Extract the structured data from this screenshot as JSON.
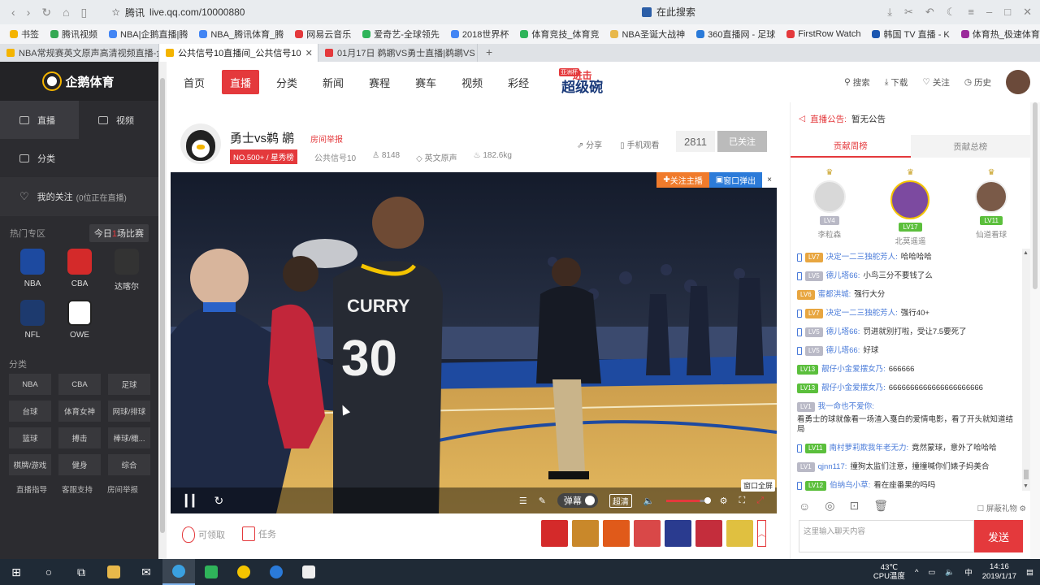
{
  "browser": {
    "url": "live.qq.com/10000880",
    "url_prefix": "腾讯",
    "search_label": "在此搜索",
    "bookmarks": [
      "书签",
      "腾讯视频",
      "NBA|企鹅直播|腾",
      "NBA_腾讯体育_腾",
      "网易云音乐",
      "爱奇艺-全球领先",
      "2018世界杯",
      "体育竞技_体育竞",
      "NBA圣诞大战神",
      "360直播网 - 足球",
      "FirstRow Watch",
      "韩国 TV 直播 - K",
      "体育热_极速体育"
    ],
    "tabs": [
      {
        "label": "NBA常规赛英文原声高清视频直播-企",
        "active": false
      },
      {
        "label": "公共信号10直播间_公共信号10",
        "active": true
      },
      {
        "label": "01月17日 鹈鹕VS勇士直播|鹈鹕VS",
        "active": false
      }
    ]
  },
  "sidebar": {
    "brand": "企鹅体育",
    "nav": [
      "直播",
      "视频",
      "分类"
    ],
    "my_follow": "我的关注",
    "my_follow_sub": "(0位正在直播)",
    "hot_zone": "热门专区",
    "today_matches_prefix": "今日",
    "today_matches_count": "1",
    "today_matches_suffix": "场比赛",
    "leagues": [
      "NBA",
      "CBA",
      "达喀尔",
      "NFL",
      "OWE"
    ],
    "category_title": "分类",
    "categories": [
      "NBA",
      "CBA",
      "足球",
      "台球",
      "体育女神",
      "网球/排球",
      "篮球",
      "搏击",
      "棒球/橄...",
      "棋牌/游戏",
      "健身",
      "综合"
    ],
    "footer": [
      "直播指导",
      "客服支持",
      "房间举报"
    ]
  },
  "topnav": {
    "items": [
      "首页",
      "直播",
      "分类",
      "新闻",
      "赛程",
      "赛车",
      "视频",
      "彩经"
    ],
    "active": "直播",
    "badge": "亚洲杯",
    "promo_top": "进击",
    "promo_main": "超级碗",
    "search": "搜索",
    "download": "下载",
    "follow": "关注",
    "history": "历史"
  },
  "room": {
    "title": "勇士vs鹈 鹕",
    "report": "房间举报",
    "rank": "NO.500+ / 星秀榜",
    "channel": "公共信号10",
    "viewers": "8148",
    "audio": "英文原声",
    "weight": "182.6kg",
    "share": "分享",
    "mobile": "手机观看",
    "follow_count": "2811",
    "followed": "已关注"
  },
  "video": {
    "follow_host": "关注主播",
    "popout": "窗口弹出",
    "close": "×",
    "danmaku": "弹幕",
    "quality": "超清",
    "fullscreen_tip": "窗口全屏",
    "volume": 0.8,
    "jersey_name": "CURRY",
    "jersey_number": "30"
  },
  "below": {
    "claimable": "可领取",
    "tasks": "任务",
    "gift_colors": [
      "#d42a2a",
      "#c9882a",
      "#e05a1a",
      "#d94848",
      "#2a3b8f",
      "#c42d3c",
      "#e0c040"
    ]
  },
  "right": {
    "notice_label": "直播公告:",
    "notice_text": "暂无公告",
    "tab_week": "贡献周榜",
    "tab_total": "贡献总榜",
    "top3": [
      {
        "name": "李粒森",
        "level": "LV4",
        "color": "#d8d8d8"
      },
      {
        "name": "北莫遥遥",
        "level": "LV17",
        "color": "#7c4aa0"
      },
      {
        "name": "仙道看球",
        "level": "LV11",
        "color": "#7a5a48"
      }
    ],
    "messages": [
      {
        "level": "LV7",
        "lvcolor": "#e8a640",
        "phone": true,
        "name": "决定一二三独舵芳人:",
        "text": "哈哈哈哈"
      },
      {
        "level": "LV5",
        "lvcolor": "#b9b9c6",
        "phone": true,
        "name": "德儿塔66:",
        "text": "小鸟三分不要钱了么"
      },
      {
        "level": "LV6",
        "lvcolor": "#e8a640",
        "phone": false,
        "name": "蜜都洪城:",
        "text": "强行大分"
      },
      {
        "level": "LV7",
        "lvcolor": "#e8a640",
        "phone": true,
        "name": "决定一二三独舵芳人:",
        "text": "强行40+"
      },
      {
        "level": "LV5",
        "lvcolor": "#b9b9c6",
        "phone": true,
        "name": "德儿塔66:",
        "text": "罚进就别打啦，受让7.5要死了"
      },
      {
        "level": "LV5",
        "lvcolor": "#b9b9c6",
        "phone": true,
        "name": "德儿塔66:",
        "text": "好球"
      },
      {
        "level": "LV13",
        "lvcolor": "#5bbf3c",
        "phone": false,
        "name": "靓仔小金爱摆女乃:",
        "text": "666666"
      },
      {
        "level": "LV13",
        "lvcolor": "#5bbf3c",
        "phone": false,
        "name": "靓仔小金爱摆女乃:",
        "text": "6666666666666666666666"
      },
      {
        "level": "LV1",
        "lvcolor": "#b9b9c6",
        "phone": false,
        "name": "我一命也不爱你:",
        "text": "看勇士的球就像看一场渣入戛白的爱情电影，看了开头就知道结局"
      },
      {
        "level": "LV11",
        "lvcolor": "#5bbf3c",
        "phone": true,
        "name": "南村萝莉欺我年老无力:",
        "text": "竟然蒙球，意外了哈哈哈"
      },
      {
        "level": "LV1",
        "lvcolor": "#b9b9c6",
        "phone": false,
        "name": "qjnn117:",
        "text": "撞狗太监们注意，撞撞喊你们婊子妈美合"
      },
      {
        "level": "LV12",
        "lvcolor": "#5bbf3c",
        "phone": true,
        "name": "伯纳乌小草:",
        "text": "看在座番果的吗吗"
      }
    ],
    "shield_gift": "屏蔽礼物",
    "input_placeholder": "这里输入聊天内容",
    "send": "发送"
  },
  "taskbar": {
    "temp": "43℃",
    "temp_label": "CPU温度",
    "ime": "中",
    "time": "14:16",
    "date": "2019/1/17"
  }
}
